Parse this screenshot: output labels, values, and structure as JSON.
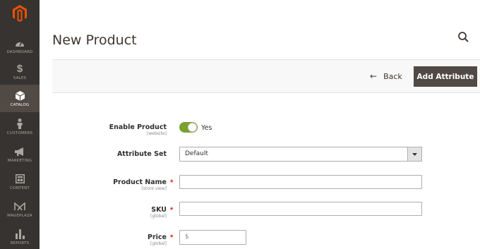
{
  "page": {
    "title": "New Product"
  },
  "sidebar": {
    "items": [
      {
        "label": "DASHBOARD",
        "icon": "dashboard-icon"
      },
      {
        "label": "SALES",
        "icon": "dollar-icon"
      },
      {
        "label": "CATALOG",
        "icon": "cube-icon",
        "active": true
      },
      {
        "label": "CUSTOMERS",
        "icon": "person-icon"
      },
      {
        "label": "MARKETING",
        "icon": "megaphone-icon"
      },
      {
        "label": "CONTENT",
        "icon": "layout-icon"
      },
      {
        "label": "MAGEPLAZA",
        "icon": "mageplaza-icon"
      },
      {
        "label": "REPORTS",
        "icon": "bar-chart-icon"
      }
    ]
  },
  "actions": {
    "back_label": "Back",
    "add_attribute_label": "Add Attribute"
  },
  "form": {
    "enable_product": {
      "label": "Enable Product",
      "scope": "[website]",
      "value": "Yes"
    },
    "attribute_set": {
      "label": "Attribute Set",
      "value": "Default"
    },
    "product_name": {
      "label": "Product Name",
      "scope": "[store view]",
      "value": ""
    },
    "sku": {
      "label": "SKU",
      "scope": "[global]",
      "value": ""
    },
    "price": {
      "label": "Price",
      "scope": "[global]",
      "prefix": "$",
      "value": ""
    }
  },
  "colors": {
    "sidebar": "#373330",
    "sidebar_active": "#514943",
    "brand": "#eb5202",
    "toggle_on": "#79a22e",
    "required": "#e22626"
  }
}
